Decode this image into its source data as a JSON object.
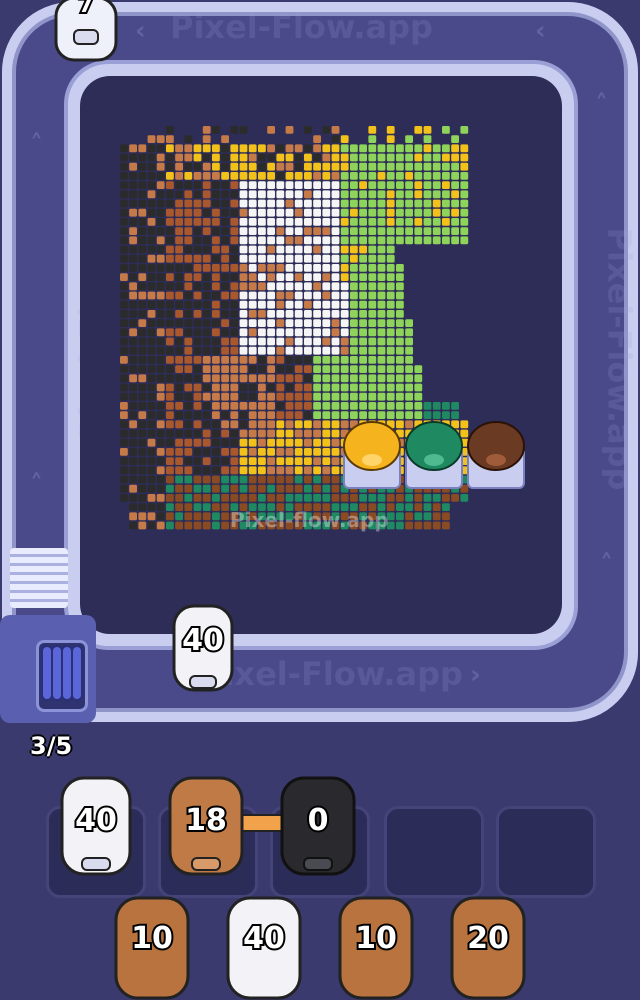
{
  "watermark": "Pixel-Flow.app",
  "board_watermark": "Pixel-flow.app",
  "top_pig_count": "7",
  "track_pig_count": "40",
  "queue_counter": "3/5",
  "slots": [
    {
      "count": "40",
      "color": "#f2f2f7"
    },
    {
      "count": "18",
      "color": "#c07a45"
    },
    {
      "count": "0",
      "color": "#2a2a2e"
    }
  ],
  "queue": [
    {
      "count": "10",
      "color": "#b8733f"
    },
    {
      "count": "40",
      "color": "#f2f2f7"
    },
    {
      "count": "10",
      "color": "#b8733f"
    },
    {
      "count": "20",
      "color": "#b8733f"
    }
  ],
  "board_pigs": [
    {
      "color": "#f5b41e"
    },
    {
      "color": "#1f8a62"
    },
    {
      "color": "#6b3a22"
    }
  ],
  "colors": {
    "background": "#3b3a6e",
    "track": "#c9cdf0",
    "board": "#2d2d58"
  },
  "icons": [
    "chevron-left-icon",
    "chevron-up-icon",
    "chevron-right-icon"
  ]
}
